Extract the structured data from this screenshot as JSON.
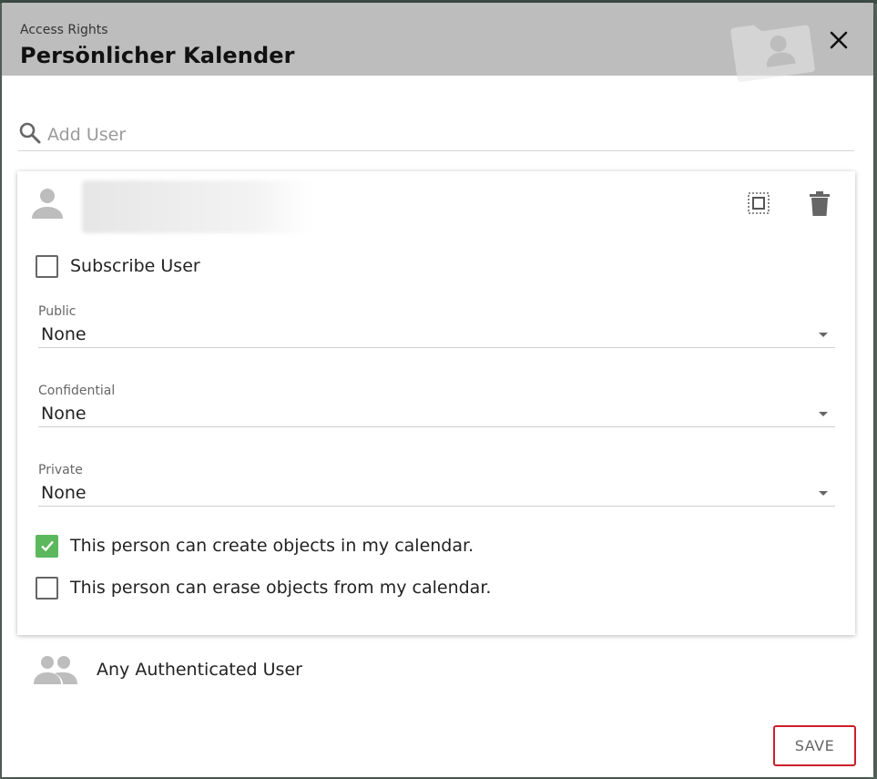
{
  "dialog": {
    "subtitle": "Access Rights",
    "title": "Persönlicher Kalender"
  },
  "search": {
    "placeholder": "Add User",
    "value": ""
  },
  "user_entry": {
    "subscribe": {
      "label": "Subscribe User",
      "checked": false
    },
    "selects": [
      {
        "label": "Public",
        "value": "None"
      },
      {
        "label": "Confidential",
        "value": "None"
      },
      {
        "label": "Private",
        "value": "None"
      }
    ],
    "permissions": [
      {
        "label": "This person can create objects in my calendar.",
        "checked": true
      },
      {
        "label": "This person can erase objects from my calendar.",
        "checked": false
      }
    ]
  },
  "group_entry": {
    "label": "Any Authenticated User"
  },
  "footer": {
    "save_label": "SAVE"
  },
  "colors": {
    "header_bg": "#bdbdbd",
    "checked_green": "#5cb85c",
    "highlight_red": "#cc1f2a"
  },
  "icons": [
    "folder-user-icon",
    "close-icon",
    "search-icon",
    "person-icon",
    "copy-icon",
    "trash-icon",
    "checkmark-icon",
    "people-icon",
    "chevron-down-icon"
  ]
}
